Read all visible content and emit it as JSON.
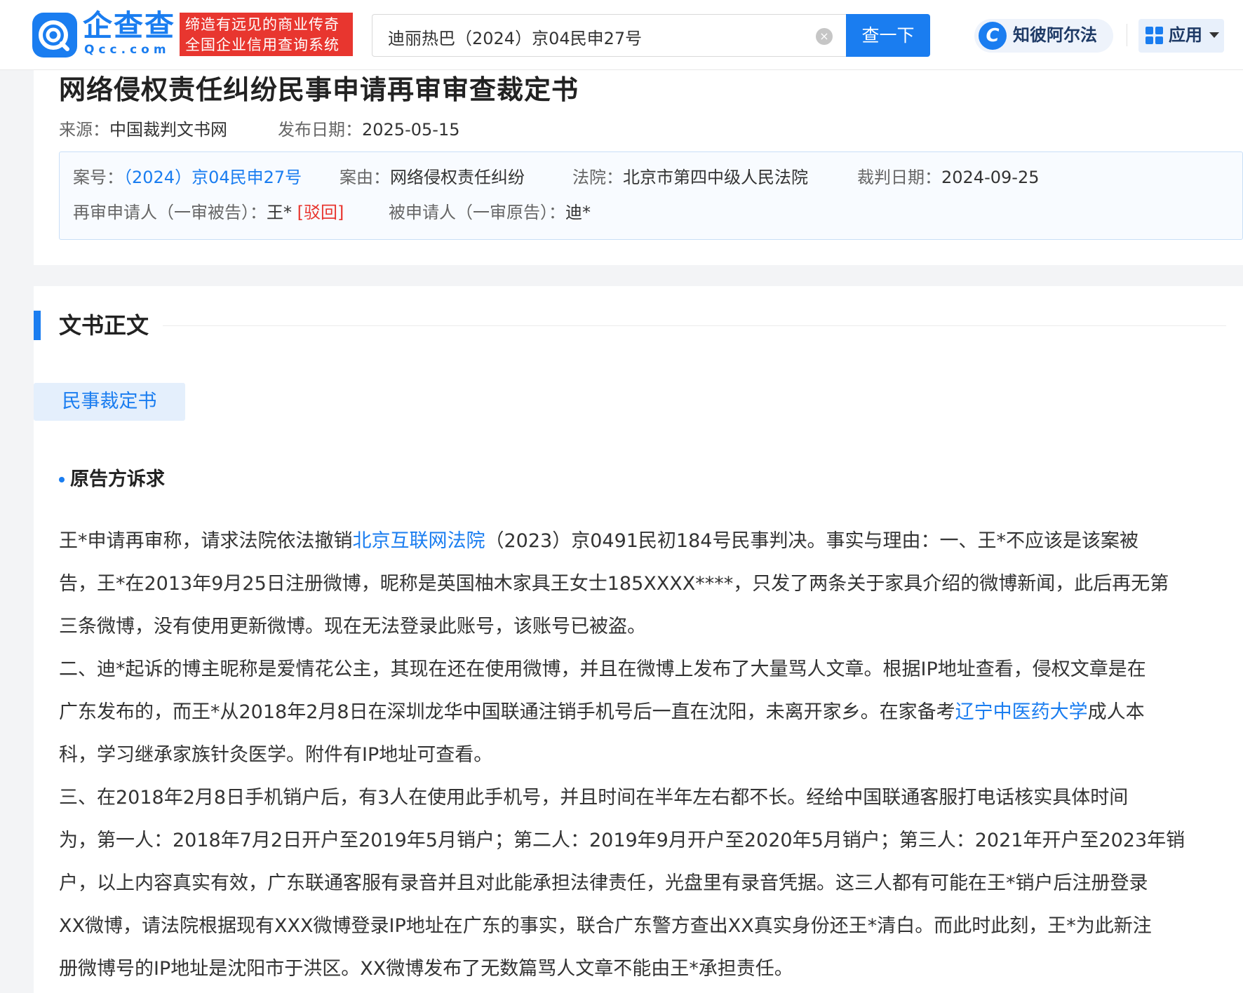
{
  "header": {
    "logo_name": "企查查",
    "logo_domain": "Qcc.com",
    "slogan_line1": "缔造有远见的商业传奇",
    "slogan_line2": "全国企业信用查询系统",
    "search_value": "迪丽热巴（2024）京04民申27号",
    "search_button": "查一下",
    "ai_label": "知彼阿尔法",
    "apps_label": "应用",
    "brand_color": "#1a7df0",
    "slogan_color": "#e8362f"
  },
  "document": {
    "title": "网络侵权责任纠纷民事申请再审审查裁定书",
    "source_label": "来源：",
    "source_value": "中国裁判文书网",
    "publish_label": "发布日期：",
    "publish_value": "2025-05-15",
    "case_no_label": "案号：",
    "case_no_value": "（2024）京04民申27号",
    "cause_label": "案由：",
    "cause_value": "网络侵权责任纠纷",
    "court_label": "法院：",
    "court_value": "北京市第四中级人民法院",
    "judge_date_label": "裁判日期：",
    "judge_date_value": "2024-09-25",
    "applicant_label": "再审申请人（一审被告）：",
    "applicant_value": "王*",
    "applicant_tag": "[驳回]",
    "respondent_label": "被申请人（一审原告）：",
    "respondent_value": "迪*"
  },
  "body": {
    "section_title": "文书正文",
    "doc_tab": "民事裁定书",
    "subsection_title": "原告方诉求",
    "line1_pre": "王*申请再审称，请求法院依法撤销",
    "line1_link": "北京互联网法院",
    "line1_post": "（2023）京0491民初184号民事判决。事实与理由：一、王*不应该是该案被",
    "line2": "告，王*在2013年9月25日注册微博，昵称是英国柚木家具王女士185XXXX****，只发了两条关于家具介绍的微博新闻，此后再无第",
    "line3": "三条微博，没有使用更新微博。现在无法登录此账号，该账号已被盗。",
    "line4": "二、迪*起诉的博主昵称是爱情花公主，其现在还在使用微博，并且在微博上发布了大量骂人文章。根据IP地址查看，侵权文章是在",
    "line5_pre": "广东发布的，而王*从2018年2月8日在深圳龙华中国联通注销手机号后一直在沈阳，未离开家乡。在家备考",
    "line5_link": "辽宁中医药大学",
    "line5_post": "成人本",
    "line6": "科，学习继承家族针灸医学。附件有IP地址可查看。",
    "line7": "三、在2018年2月8日手机销户后，有3人在使用此手机号，并且时间在半年左右都不长。经给中国联通客服打电话核实具体时间",
    "line8": "为，第一人：2018年7月2日开户至2019年5月销户；第二人：2019年9月开户至2020年5月销户；第三人：2021年开户至2023年销",
    "line9": "户，以上内容真实有效，广东联通客服有录音并且对此能承担法律责任，光盘里有录音凭据。这三人都有可能在王*销户后注册登录",
    "line10": "XX微博，请法院根据现有XXX微博登录IP地址在广东的事实，联合广东警方查出XX真实身份还王*清白。而此时此刻，王*为此新注",
    "line11": "册微博号的IP地址是沈阳市于洪区。XX微博发布了无数篇骂人文章不能由王*承担责任。"
  }
}
